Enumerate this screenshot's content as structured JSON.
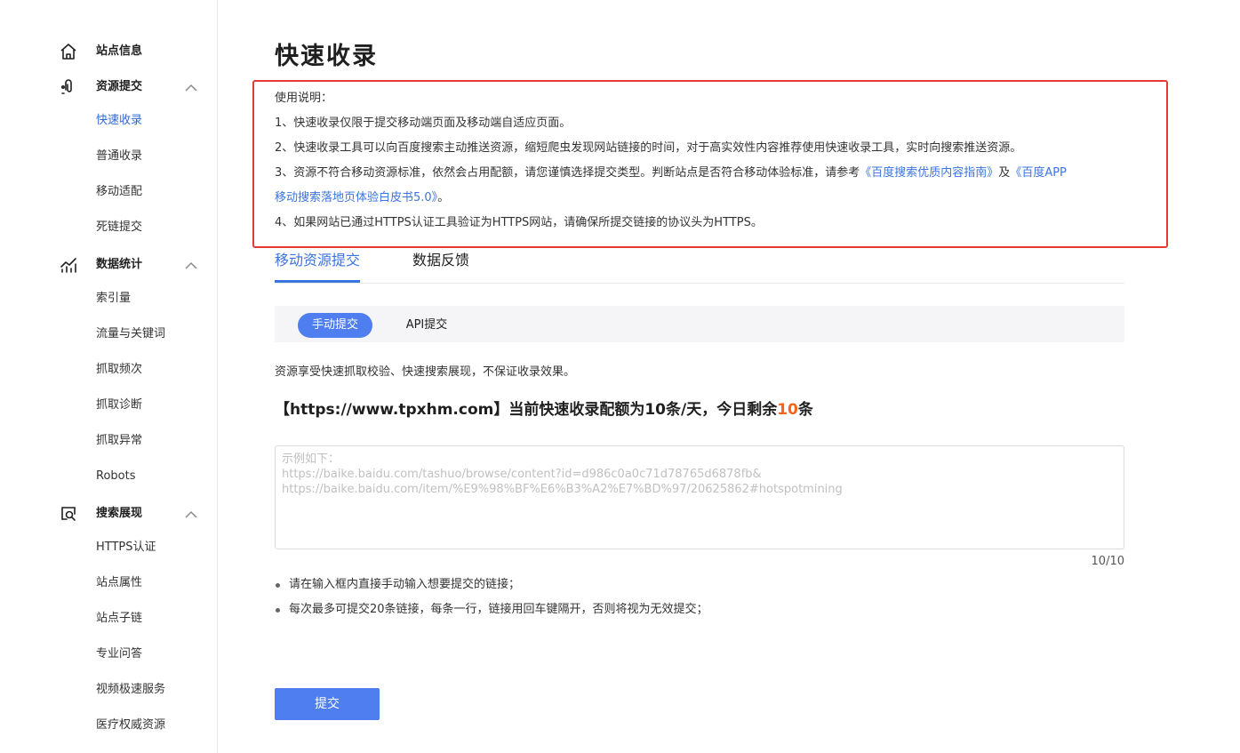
{
  "sidebar": {
    "site_info": {
      "label": "站点信息",
      "icon": "home-icon"
    },
    "groups": [
      {
        "label": "资源提交",
        "icon": "resource-submit-icon",
        "items": [
          "快速收录",
          "普通收录",
          "移动适配",
          "死链提交"
        ]
      },
      {
        "label": "数据统计",
        "icon": "data-stats-icon",
        "items": [
          "索引量",
          "流量与关键词",
          "抓取频次",
          "抓取诊断",
          "抓取异常",
          "Robots"
        ]
      },
      {
        "label": "搜索展现",
        "icon": "search-display-icon",
        "items": [
          "HTTPS认证",
          "站点属性",
          "站点子链",
          "专业问答",
          "视频极速服务",
          "医疗权威资源"
        ]
      }
    ],
    "active_item": "快速收录"
  },
  "main": {
    "title": "快速收录",
    "notice": {
      "title": "使用说明：",
      "line1": "1、快速收录仅限于提交移动端页面及移动端自适应页面。",
      "line2": "2、快速收录工具可以向百度搜索主动推送资源，缩短爬虫发现网站链接的时间，对于高实效性内容推荐使用快速收录工具，实时向搜索推送资源。",
      "line3_text": "3、资源不符合移动资源标准，依然会占用配额，请您谨慎选择提交类型。判断站点是否符合移动体验标准，请参考",
      "line3_link1": "《百度搜索优质内容指南》",
      "line3_and": "及",
      "line3_link2_part1": "《百度APP",
      "line3_link2_part2": "移动搜索落地页体验白皮书5.0》",
      "line3_end": "。",
      "line4": "4、如果网站已通过HTTPS认证工具验证为HTTPS网站，请确保所提交链接的协议头为HTTPS。"
    },
    "tabs": [
      {
        "label": "移动资源提交",
        "active": true
      },
      {
        "label": "数据反馈",
        "active": false
      }
    ],
    "submit_modes": {
      "manual": "手动提交",
      "api": "API提交"
    },
    "description": "资源享受快速抓取校验、快速搜索展现，不保证收录效果。",
    "quota": {
      "prefix": "【https://www.tpxhm.com】当前快速收录配额为10条/天，今日剩余",
      "remaining": "10",
      "suffix": "条"
    },
    "url_input": {
      "value": "",
      "placeholder": "示例如下：\nhttps://baike.baidu.com/tashuo/browse/content?id=d986c0a0c71d78765d6878fb&\nhttps://baike.baidu.com/item/%E9%98%BF%E6%B3%A2%E7%BD%97/20625862#hotspotmining"
    },
    "counter": "10/10",
    "tips": [
      "请在输入框内直接手动输入想要提交的链接；",
      "每次最多可提交20条链接，每条一行，链接用回车键隔开，否则将视为无效提交；"
    ],
    "submit_label": "提交"
  },
  "colors": {
    "accent": "#3b74e0",
    "button": "#4e7ef0",
    "highlight": "#f5641a",
    "notice_border": "#e53935"
  }
}
